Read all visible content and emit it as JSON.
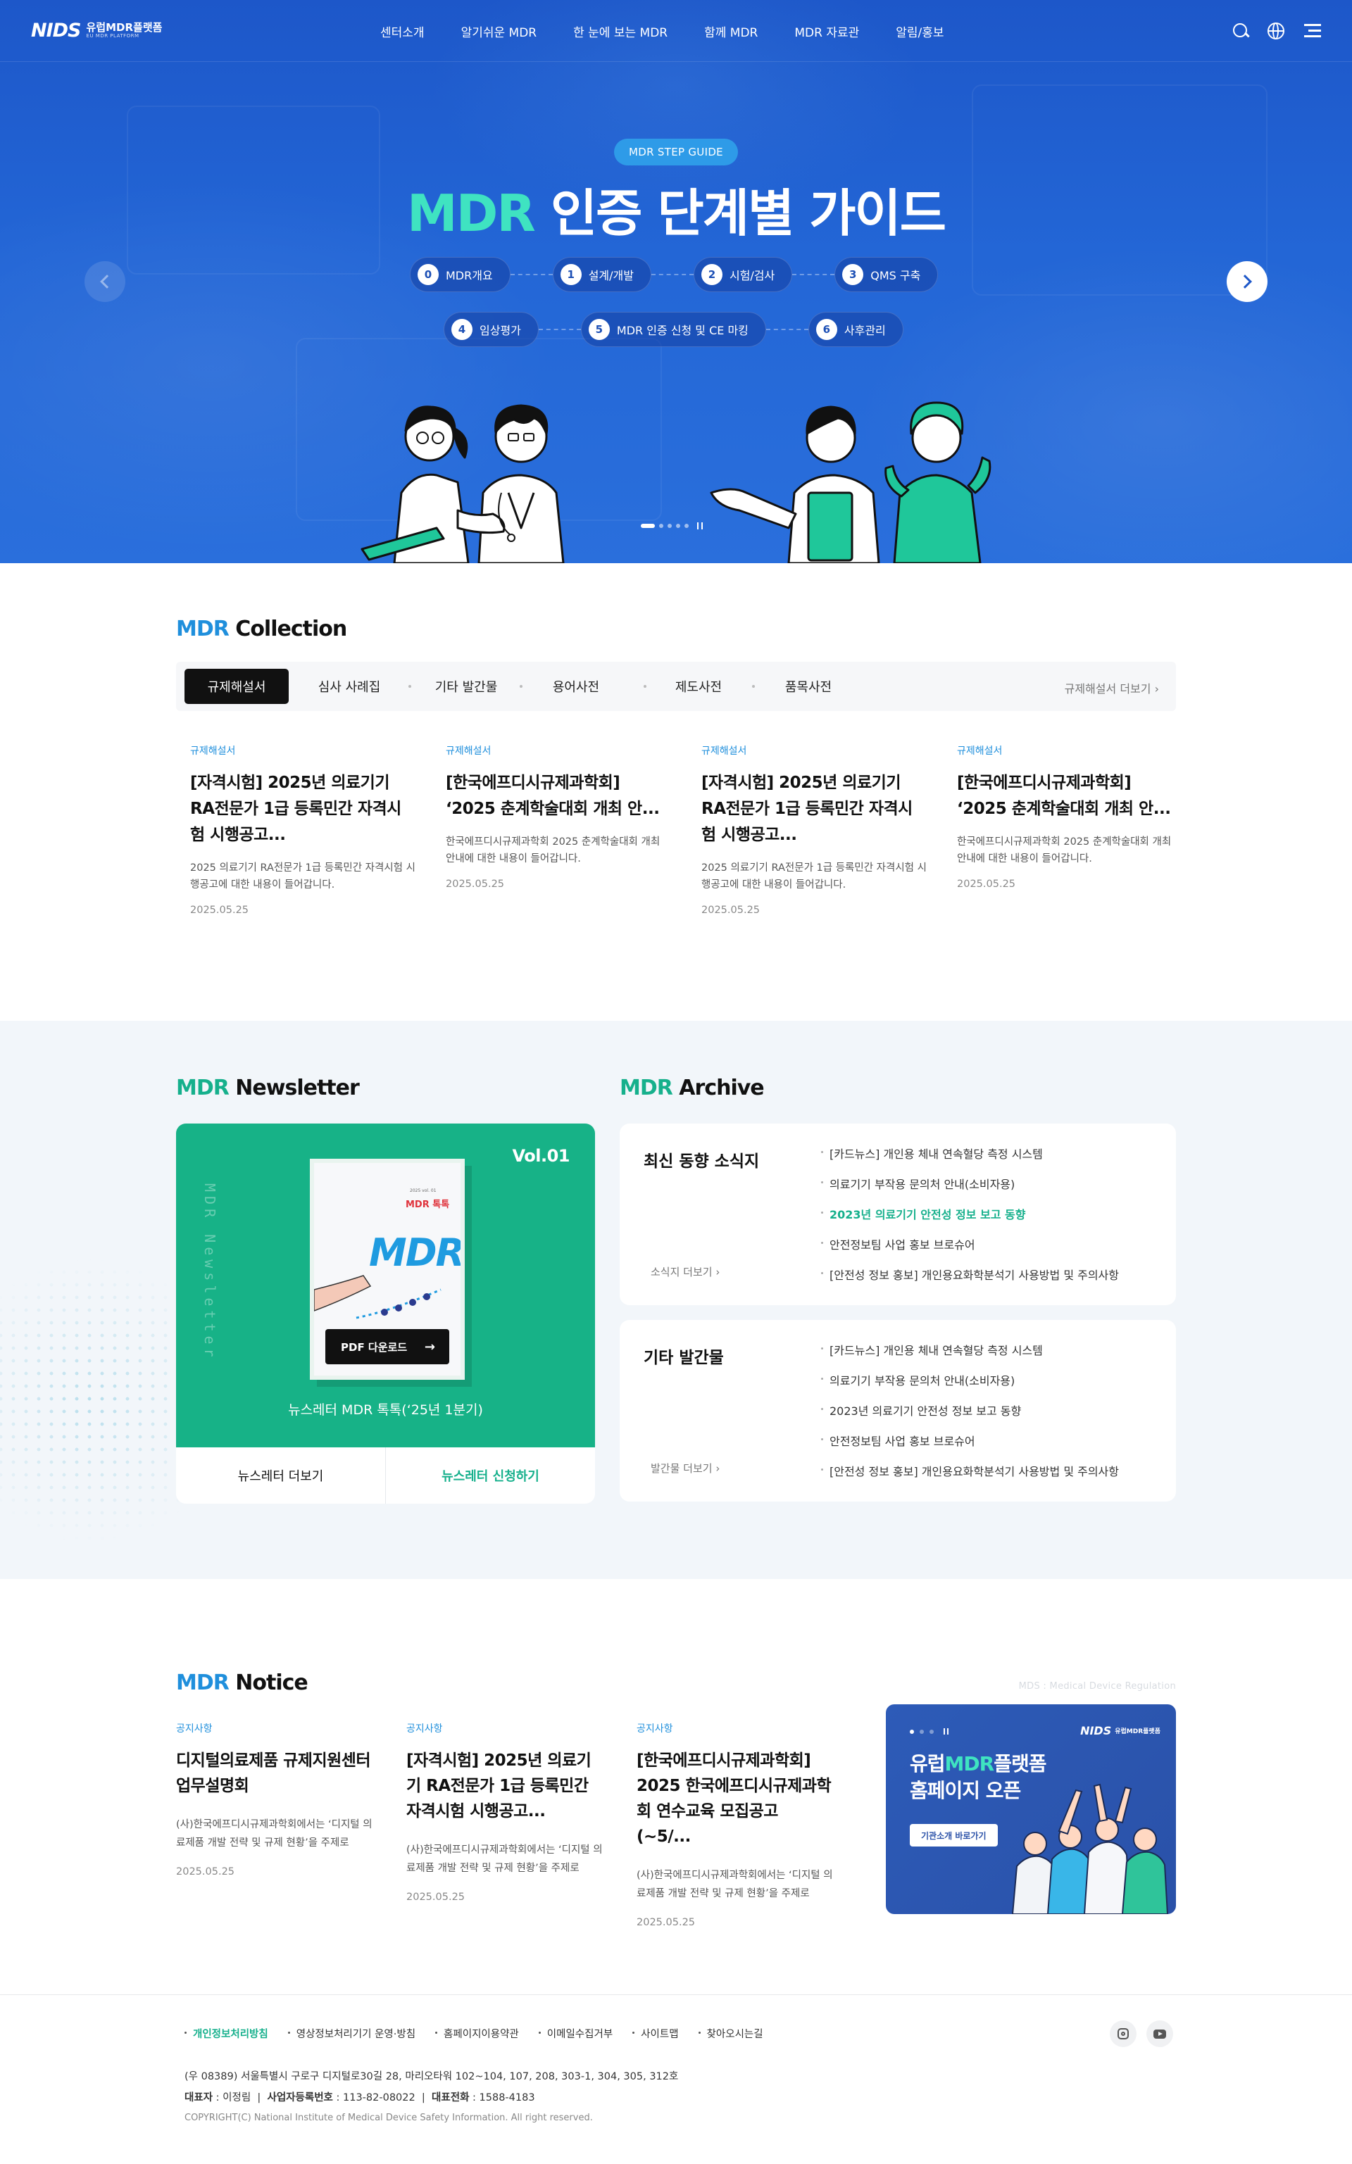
{
  "header": {
    "logo_mark": "NIDS",
    "logo_kr": "유럽MDR플랫폼",
    "logo_en": "EU MDR PLATFORM",
    "menu": [
      "센터소개",
      "알기쉬운 MDR",
      "한 눈에 보는 MDR",
      "함께 MDR",
      "MDR 자료관",
      "알림/홍보"
    ],
    "icons": [
      "search-icon",
      "globe-icon",
      "hamburger-menu-icon"
    ]
  },
  "hero": {
    "badge": "MDR STEP GUIDE",
    "title_accent": "MDR",
    "title_rest": " 인증 단계별 가이드",
    "steps_row1": [
      {
        "num": "0",
        "label": "MDR개요"
      },
      {
        "num": "1",
        "label": "설계/개발"
      },
      {
        "num": "2",
        "label": "시험/검사"
      },
      {
        "num": "3",
        "label": "QMS 구축"
      }
    ],
    "steps_row2": [
      {
        "num": "4",
        "label": "임상평가"
      },
      {
        "num": "5",
        "label": "MDR 인증 신청 및 CE 마킹"
      },
      {
        "num": "6",
        "label": "사후관리"
      }
    ]
  },
  "collection": {
    "title_accent": "MDR",
    "title_rest": " Collection",
    "tabs": [
      "규제해설서",
      "심사 사례집",
      "기타 발간물",
      "용어사전",
      "제도사전",
      "품목사전"
    ],
    "more": "규제해설서 더보기",
    "cards": [
      {
        "category": "규제해설서",
        "title": "[자격시험] 2025년 의료기기 RA전문가 1급 등록민간 자격시험 시행공고...",
        "desc": "2025 의료기기 RA전문가 1급 등록민간 자격시험 시행공고에 대한 내용이 들어갑니다.",
        "date": "2025.05.25"
      },
      {
        "category": "규제해설서",
        "title": "[한국에프디시규제과학회] ‘2025 춘계학술대회 개최 안...",
        "desc": "한국에프디시규제과학회 2025 춘계학술대회 개최 안내에 대한 내용이 들어갑니다.",
        "date": "2025.05.25"
      },
      {
        "category": "규제해설서",
        "title": "[자격시험] 2025년 의료기기 RA전문가 1급 등록민간 자격시험 시행공고...",
        "desc": "2025 의료기기 RA전문가 1급 등록민간 자격시험 시행공고에 대한 내용이 들어갑니다.",
        "date": "2025.05.25"
      },
      {
        "category": "규제해설서",
        "title": "[한국에프디시규제과학회] ‘2025 춘계학술대회 개최 안...",
        "desc": "한국에프디시규제과학회 2025 춘계학술대회 개최 안내에 대한 내용이 들어갑니다.",
        "date": "2025.05.25"
      }
    ]
  },
  "newsletter": {
    "title_accent": "MDR",
    "title_rest": " Newsletter",
    "vol": "Vol.01",
    "vertical_text": "MDR Newsletter",
    "book_big": "MDR",
    "book_small": "MDR 톡톡",
    "book_tiny": "2025 vol. 01",
    "pdf_button": "PDF 다운로드",
    "caption": "뉴스레터 MDR 톡톡(‘25년 1분기)",
    "more_button": "뉴스레터 더보기",
    "subscribe_button": "뉴스레터 신청하기"
  },
  "archive": {
    "title_accent": "MDR",
    "title_rest": " Archive",
    "boxes": [
      {
        "title": "최신 동향 소식지",
        "more": "소식지 더보기",
        "items": [
          "[카드뉴스] 개인용 체내 연속혈당 측정 시스템",
          "의료기기 부작용 문의처 안내(소비자용)",
          "2023년 의료기기 안전성 정보 보고 동향",
          "안전정보팀 사업 홍보 브로슈어",
          "[안전성 정보 홍보] 개인용요화학분석기 사용방법 및 주의사항"
        ],
        "highlight_index": 2
      },
      {
        "title": "기타 발간물",
        "more": "발간물 더보기",
        "items": [
          "[카드뉴스] 개인용 체내 연속혈당 측정 시스템",
          "의료기기 부작용 문의처 안내(소비자용)",
          "2023년 의료기기 안전성 정보 보고 동향",
          "안전정보팀 사업 홍보 브로슈어",
          "[안전성 정보 홍보] 개인용요화학분석기 사용방법 및 주의사항"
        ],
        "highlight_index": -1
      }
    ]
  },
  "notice": {
    "title_accent": "MDR",
    "title_rest": " Notice",
    "tag": "MDS : Medical Device Regulation",
    "cards": [
      {
        "category": "공지사항",
        "title": "디지털의료제품 규제지원센터 업무설명회",
        "desc": "(사)한국에프디시규제과학회에서는 ‘디지털 의료제품 개발 전략 및 규제 현황’을 주제로",
        "date": "2025.05.25"
      },
      {
        "category": "공지사항",
        "title": "[자격시험] 2025년 의료기기 RA전문가 1급 등록민간 자격시험 시행공고...",
        "desc": "(사)한국에프디시규제과학회에서는 ‘디지털 의료제품 개발 전략 및 규제 현황’을 주제로",
        "date": "2025.05.25"
      },
      {
        "category": "공지사항",
        "title": "[한국에프디시규제과학회] 2025 한국에프디시규제과학회 연수교육 모집공고 (~5/...",
        "desc": "(사)한국에프디시규제과학회에서는 ‘디지털 의료제품 개발 전략 및 규제 현황’을 주제로",
        "date": "2025.05.25"
      }
    ],
    "banner": {
      "logo_mark": "NIDS",
      "logo_kr": "유럽MDR플랫폼",
      "title_line1_pre": "유럽",
      "title_line1_accent": "MDR",
      "title_line1_post": "플랫폼",
      "title_line2": "홈페이지 오픈",
      "button": "기관소개 바로가기"
    }
  },
  "footer": {
    "links": [
      "개인정보처리방침",
      "영상정보처리기기 운영·방침",
      "홈페이지이용약관",
      "이메일수집거부",
      "사이트맵",
      "찾아오시는길"
    ],
    "address": "(우 08389) 서울특별시 구로구 디지털로30길 28, 마리오타워 102~104, 107, 208, 303-1, 304, 305, 312호",
    "ceo_label": "대표자",
    "ceo": "이정림",
    "biz_label": "사업자등록번호",
    "biz": "113-82-08022",
    "tel_label": "대표전화",
    "tel": "1588-4183",
    "copyright": "COPYRIGHT(C) National Institute of Medical Device Safety Information. All right reserved.",
    "sns": [
      "instagram-icon",
      "youtube-icon"
    ]
  },
  "colors": {
    "hero_blue": "#2366d6",
    "accent_mint": "#3fe3c1",
    "accent_blue": "#1f8fdc",
    "accent_green": "#16b08c"
  }
}
